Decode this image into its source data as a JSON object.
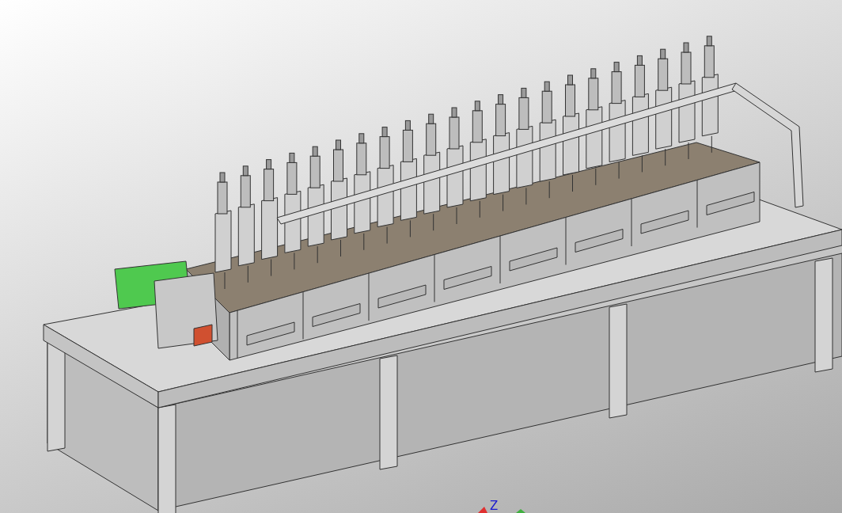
{
  "viewport": {
    "axis_label": "Z"
  }
}
